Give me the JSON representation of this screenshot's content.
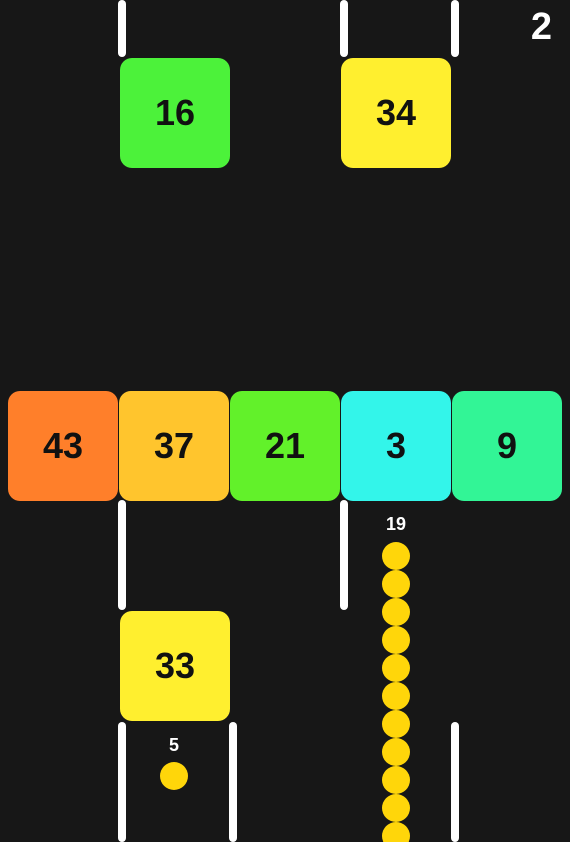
{
  "hud": {
    "score": "2"
  },
  "blocks": {
    "top_left": "16",
    "top_right": "34",
    "row": [
      "43",
      "37",
      "21",
      "3",
      "9"
    ],
    "bottom": "33"
  },
  "pickup": {
    "count": "5"
  },
  "snake": {
    "length_label": "19"
  },
  "colors": {
    "background": "#171717",
    "wall": "#ffffff",
    "green": "#4cf23a",
    "yellow": "#ffef2f",
    "orange": "#ff7f2a",
    "amber": "#ffc52d",
    "lime": "#62f12a",
    "cyan": "#33f5ea",
    "mint": "#32f596",
    "snake": "#ffd60a"
  }
}
